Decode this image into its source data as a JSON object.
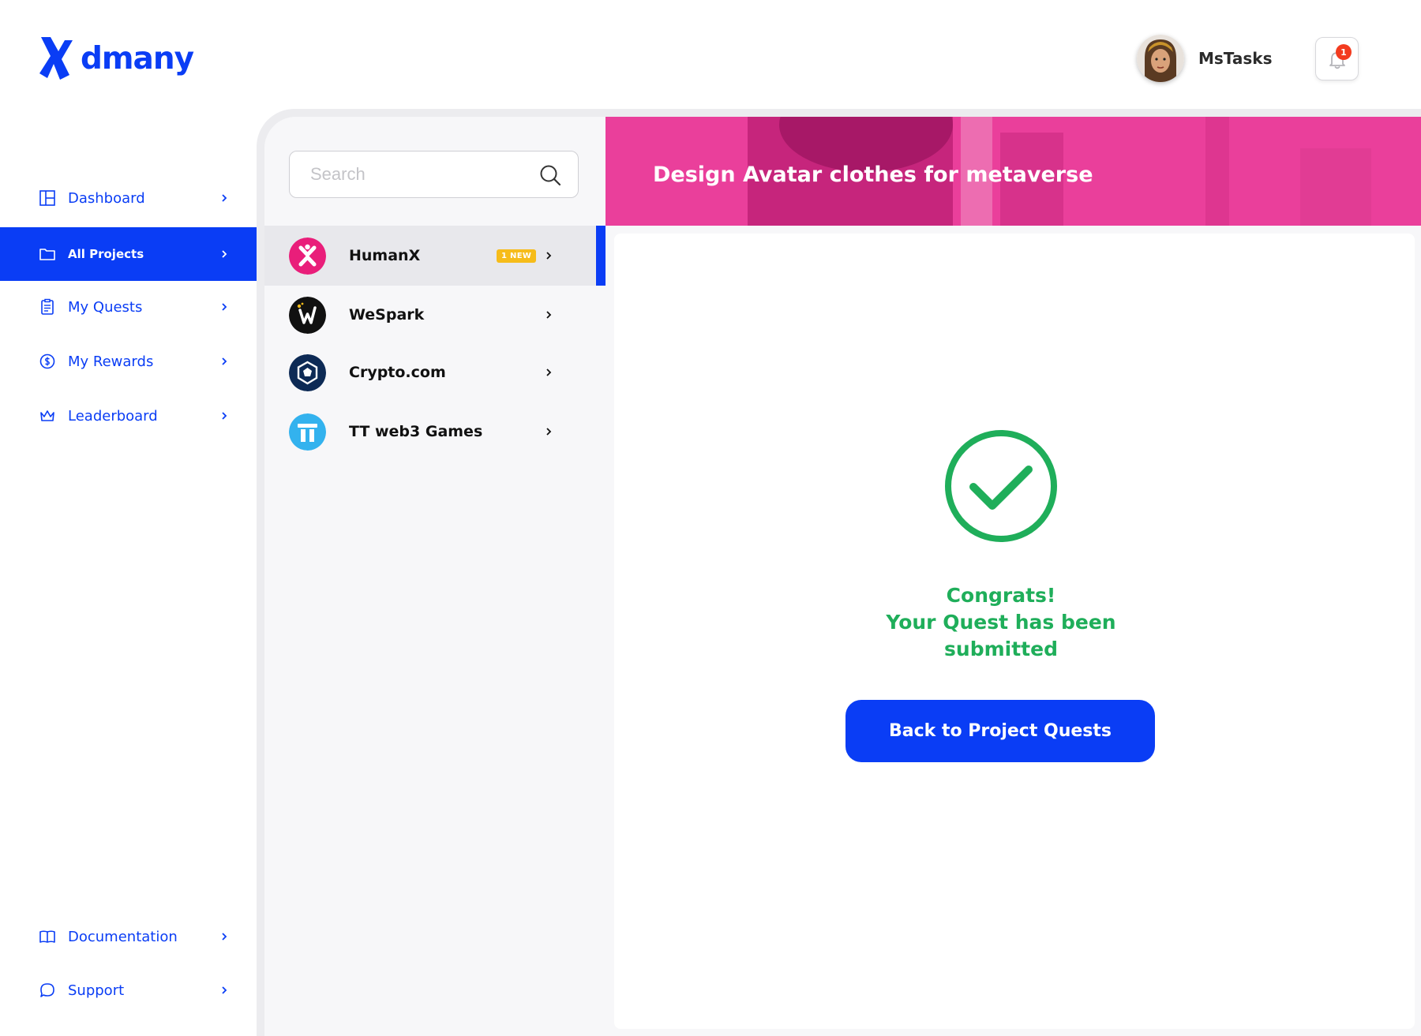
{
  "brand": {
    "name": "dmany",
    "color": "#0a3df5"
  },
  "header": {
    "user_name": "MsTasks",
    "notification_count": "1"
  },
  "nav": {
    "items": [
      {
        "label": "Dashboard",
        "icon": "dashboard-icon"
      },
      {
        "label": "All Projects",
        "icon": "folder-icon",
        "active": true
      },
      {
        "label": "My Quests",
        "icon": "clipboard-icon"
      },
      {
        "label": "My Rewards",
        "icon": "reward-coin-icon"
      },
      {
        "label": "Leaderboard",
        "icon": "crown-icon"
      }
    ],
    "bottom_items": [
      {
        "label": "Documentation",
        "icon": "book-icon"
      },
      {
        "label": "Support",
        "icon": "chat-bubble-icon"
      }
    ]
  },
  "search": {
    "placeholder": "Search",
    "value": ""
  },
  "projects": [
    {
      "name": "HumanX",
      "badge": "1 NEW",
      "active": true,
      "logo_color": "#e91e7a"
    },
    {
      "name": "WeSpark",
      "badge": "",
      "logo_color": "#111111"
    },
    {
      "name": "Crypto.com",
      "badge": "",
      "logo_color": "#0d2a55"
    },
    {
      "name": "TT web3 Games",
      "badge": "",
      "logo_color": "#33b2ee"
    }
  ],
  "quest": {
    "title": "Design Avatar clothes for metaverse",
    "banner_color": "#ea3f9b",
    "success_line1": "Congrats!",
    "success_line2": "Your Quest has been",
    "success_line3": "submitted",
    "success_color": "#1fae5a",
    "back_button_label": "Back to Project Quests"
  }
}
